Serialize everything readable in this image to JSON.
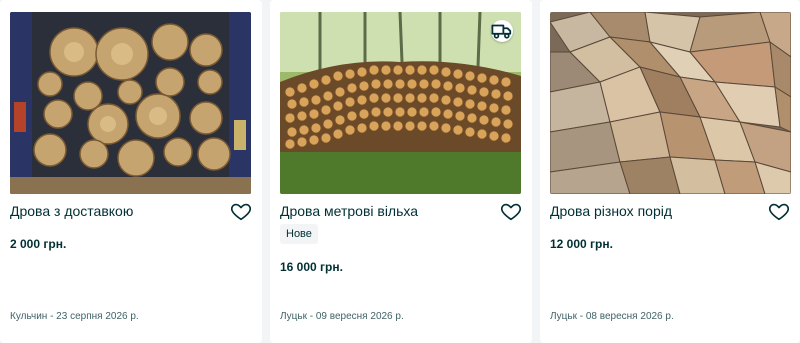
{
  "listings": [
    {
      "title": "Дрова з доставкою",
      "price": "2 000 грн.",
      "location_date": "Кульчин - 23 серпня 2026 р.",
      "photo_icon": "firewood-in-van-photo",
      "favorite_icon": "heart-outline-icon"
    },
    {
      "title": "Дрова метрові вільха",
      "badge": "Нове",
      "price": "16 000 грн.",
      "location_date": "Луцьк - 09 вересня 2026 р.",
      "photo_icon": "firewood-stack-forest-photo",
      "delivery_icon": "delivery-truck-icon",
      "favorite_icon": "heart-outline-icon"
    },
    {
      "title": "Дрова різнох порід",
      "price": "12 000 грн.",
      "location_date": "Луцьк - 08 вересня 2026 р.",
      "photo_icon": "chopped-firewood-pile-photo",
      "favorite_icon": "heart-outline-icon"
    }
  ],
  "colors": {
    "text": "#002f34",
    "meta": "#406367",
    "background": "#f2f4f5",
    "card": "#ffffff"
  }
}
